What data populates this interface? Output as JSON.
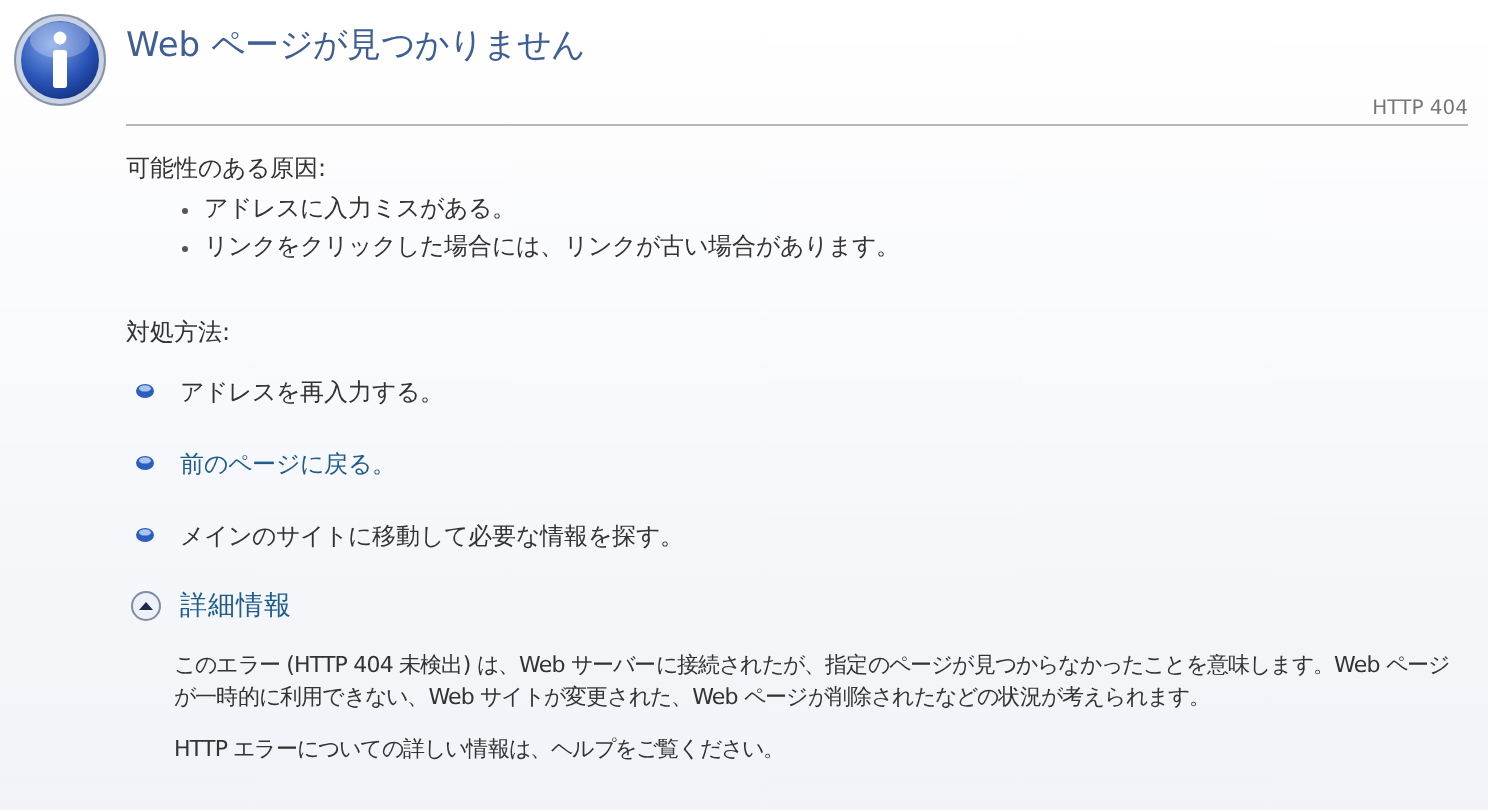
{
  "title": "Web ページが見つかりません",
  "code": "HTTP 404",
  "causes": {
    "heading": "可能性のある原因:",
    "items": [
      "アドレスに入力ミスがある。",
      "リンクをクリックした場合には、リンクが古い場合があります。"
    ]
  },
  "solutions": {
    "heading": "対処方法:",
    "items": [
      {
        "text": "アドレスを再入力する。",
        "kind": "text"
      },
      {
        "text": "前のページに戻る。",
        "kind": "link"
      },
      {
        "text": "メインのサイトに移動して必要な情報を探す。",
        "kind": "text"
      }
    ]
  },
  "details": {
    "label": "詳細情報",
    "expanded": true,
    "paragraphs": [
      "このエラー (HTTP 404 未検出) は、Web サーバーに接続されたが、指定のページが見つからなかったことを意味します。Web ページが一時的に利用できない、Web サイトが変更された、Web ページが削除されたなどの状況が考えられます。",
      "HTTP エラーについての詳しい情報は、ヘルプをご覧ください。"
    ]
  }
}
